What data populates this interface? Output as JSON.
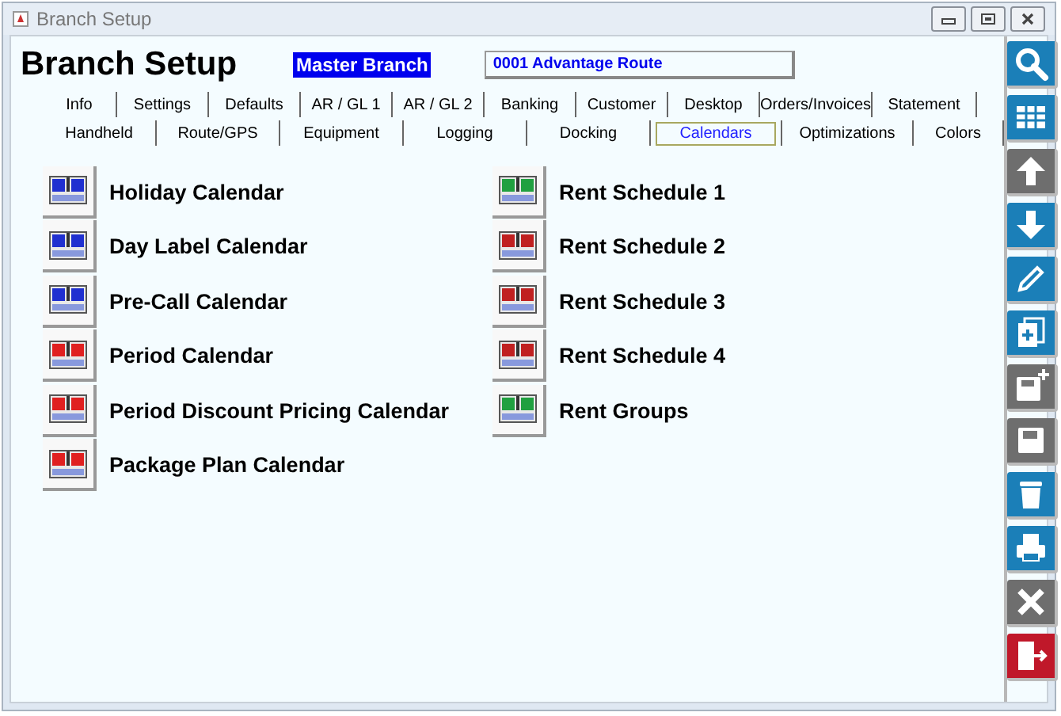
{
  "window": {
    "title": "Branch Setup"
  },
  "header": {
    "title": "Branch Setup",
    "branch_label": "Master Branch",
    "route": "0001  Advantage Route"
  },
  "tab_rows": [
    [
      {
        "label": "Info",
        "selected": false
      },
      {
        "label": "Settings",
        "selected": false
      },
      {
        "label": "Defaults",
        "selected": false
      },
      {
        "label": "AR / GL 1",
        "selected": false
      },
      {
        "label": "AR / GL 2",
        "selected": false
      },
      {
        "label": "Banking",
        "selected": false
      },
      {
        "label": "Customer",
        "selected": false
      },
      {
        "label": "Desktop",
        "selected": false
      },
      {
        "label": "Orders/Invoices",
        "selected": false
      },
      {
        "label": "Statement",
        "selected": false
      }
    ],
    [
      {
        "label": "Handheld",
        "selected": false
      },
      {
        "label": "Route/GPS",
        "selected": false
      },
      {
        "label": "Equipment",
        "selected": false
      },
      {
        "label": "Logging",
        "selected": false
      },
      {
        "label": "Docking",
        "selected": false
      },
      {
        "label": "Calendars",
        "selected": true
      },
      {
        "label": "Optimizations",
        "selected": false
      },
      {
        "label": "Colors",
        "selected": false
      }
    ]
  ],
  "calendar_columns": [
    [
      {
        "label": "Holiday Calendar",
        "color": "#2030d0"
      },
      {
        "label": "Day Label Calendar",
        "color": "#2030d0"
      },
      {
        "label": "Pre-Call Calendar",
        "color": "#2030d0"
      },
      {
        "label": "Period Calendar",
        "color": "#e02020"
      },
      {
        "label": "Period Discount Pricing Calendar",
        "color": "#e02020"
      },
      {
        "label": "Package Plan Calendar",
        "color": "#e02020"
      }
    ],
    [
      {
        "label": "Rent Schedule 1",
        "color": "#20a040"
      },
      {
        "label": "Rent Schedule 2",
        "color": "#c02020"
      },
      {
        "label": "Rent Schedule 3",
        "color": "#c02020"
      },
      {
        "label": "Rent Schedule 4",
        "color": "#c02020"
      },
      {
        "label": "Rent Groups",
        "color": "#20a040"
      }
    ]
  ],
  "toolbar": [
    {
      "kind": "search",
      "disabled": false
    },
    {
      "kind": "grid",
      "disabled": false
    },
    {
      "kind": "up",
      "disabled": true
    },
    {
      "kind": "down",
      "disabled": false
    },
    {
      "kind": "edit",
      "disabled": false
    },
    {
      "kind": "new",
      "disabled": false
    },
    {
      "kind": "save-new",
      "disabled": true
    },
    {
      "kind": "save",
      "disabled": true
    },
    {
      "kind": "delete",
      "disabled": false
    },
    {
      "kind": "print",
      "disabled": false
    },
    {
      "kind": "cancel",
      "disabled": true
    },
    {
      "kind": "exit",
      "disabled": false
    }
  ]
}
